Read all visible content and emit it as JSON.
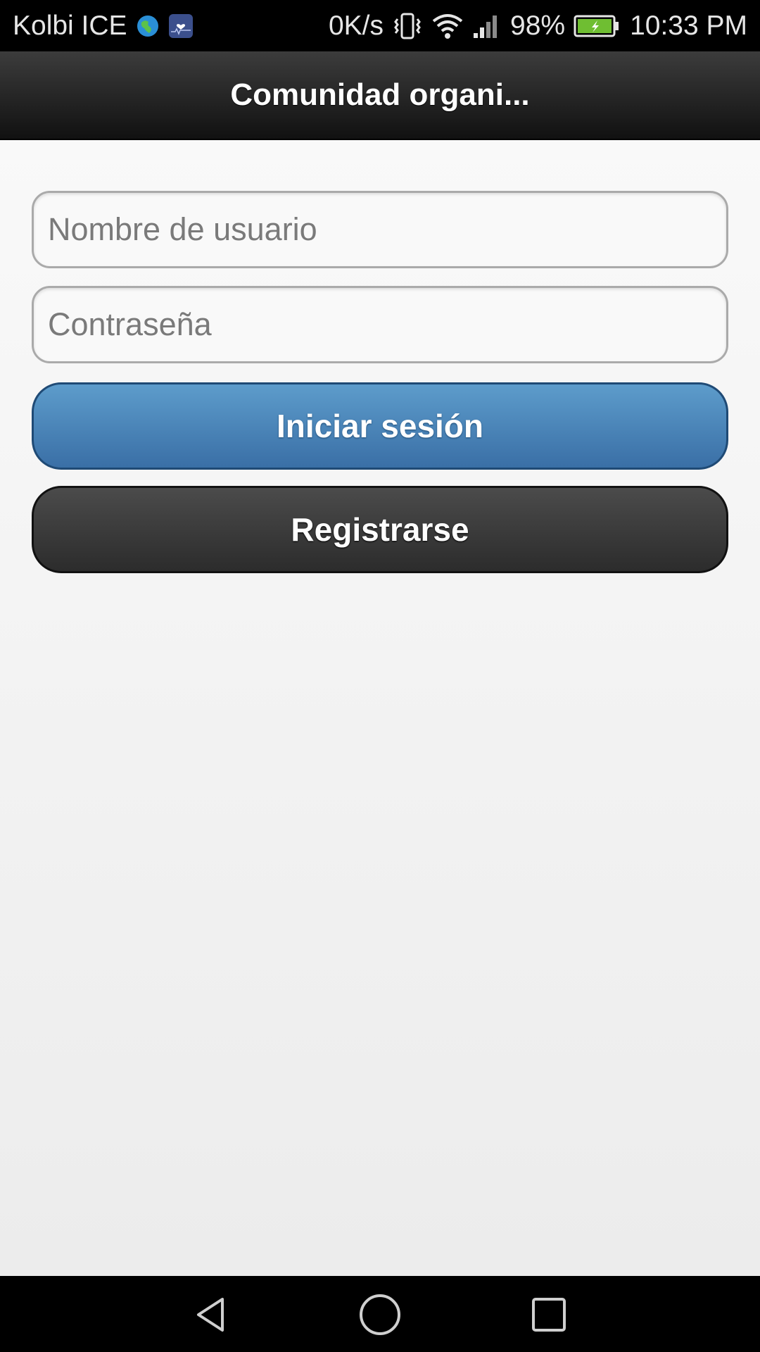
{
  "status_bar": {
    "carrier": "Kolbi ICE",
    "network_speed": "0K/s",
    "battery_percent": "98%",
    "time": "10:33 PM",
    "icons": [
      "globe-app-icon",
      "health-app-icon",
      "vibrate-icon",
      "wifi-icon",
      "signal-icon",
      "battery-charging-icon"
    ]
  },
  "header": {
    "title": "Comunidad organi..."
  },
  "login_form": {
    "username_placeholder": "Nombre de usuario",
    "username_value": "",
    "password_placeholder": "Contraseña",
    "password_value": "",
    "login_label": "Iniciar sesión",
    "register_label": "Registrarse"
  },
  "nav_bar": {
    "icons": [
      "back-icon",
      "home-icon",
      "recents-icon"
    ]
  },
  "colors": {
    "header_bg": "#1f1f1f",
    "login_button": "#4a84ba",
    "register_button": "#3b3b3b",
    "content_bg": "#f4f4f4",
    "battery_fill": "#6fbe32"
  }
}
